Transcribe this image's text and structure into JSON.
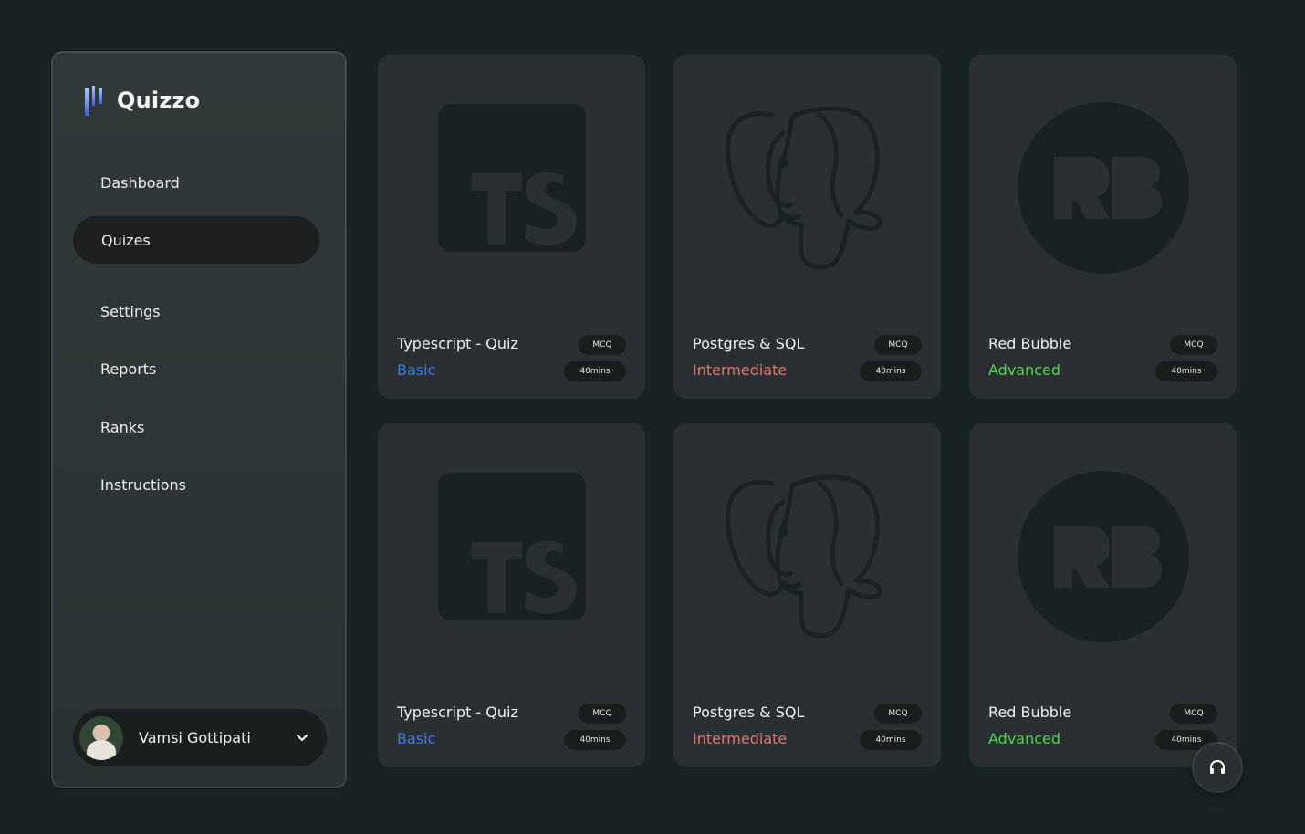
{
  "app": {
    "name": "Quizzo"
  },
  "sidebar": {
    "items": [
      {
        "label": "Dashboard"
      },
      {
        "label": "Quizes"
      },
      {
        "label": "Settings"
      },
      {
        "label": "Reports"
      },
      {
        "label": "Ranks"
      },
      {
        "label": "Instructions"
      }
    ],
    "active": "Quizes"
  },
  "user": {
    "name": "Vamsi Gottipati"
  },
  "quizzes": [
    {
      "title": "Typescript - Quiz",
      "level": "Basic",
      "level_color": "#3b7be8",
      "type": "MCQ",
      "duration": "40mins",
      "icon": "typescript-logo-icon"
    },
    {
      "title": "Postgres & SQL",
      "level": "Intermediate",
      "level_color": "#e27872",
      "type": "MCQ",
      "duration": "40mins",
      "icon": "postgres-elephant-icon"
    },
    {
      "title": "Red Bubble",
      "level": "Advanced",
      "level_color": "#4cd84c",
      "type": "MCQ",
      "duration": "40mins",
      "icon": "redbubble-logo-icon"
    },
    {
      "title": "Typescript - Quiz",
      "level": "Basic",
      "level_color": "#3b7be8",
      "type": "MCQ",
      "duration": "40mins",
      "icon": "typescript-logo-icon"
    },
    {
      "title": "Postgres & SQL",
      "level": "Intermediate",
      "level_color": "#e27872",
      "type": "MCQ",
      "duration": "40mins",
      "icon": "postgres-elephant-icon"
    },
    {
      "title": "Red Bubble",
      "level": "Advanced",
      "level_color": "#4cd84c",
      "type": "MCQ",
      "duration": "40mins",
      "icon": "redbubble-logo-icon"
    }
  ],
  "colors": {
    "background": "#172324",
    "card": "#2a3031",
    "icon_dark": "#182223",
    "logo_gradient_top": "#9fc4ff",
    "logo_gradient_bottom": "#3b5ee8"
  },
  "fab": {
    "icon": "headset-support-icon"
  }
}
